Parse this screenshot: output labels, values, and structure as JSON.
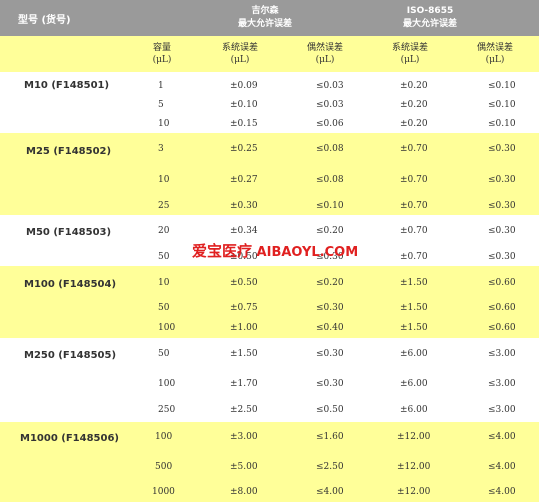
{
  "header": {
    "model_label": "型号 (货号)",
    "gilson": {
      "line1": "吉尔森",
      "line2": "最大允许误差"
    },
    "iso": {
      "line1": "ISO-8655",
      "line2": "最大允许误差"
    }
  },
  "subheader": {
    "volume": {
      "line1": "容量",
      "line2": "(μL)"
    },
    "systematic_gilson": {
      "line1": "系统误差",
      "line2": "(μL)"
    },
    "random_gilson": {
      "line1": "偶然误差",
      "line2": "(μL)"
    },
    "systematic_iso": {
      "line1": "系统误差",
      "line2": "(μL)"
    },
    "random_iso": {
      "line1": "偶然误差",
      "line2": "(μL)"
    }
  },
  "groups": [
    {
      "model": "M10 (F148501)",
      "rows": [
        {
          "volume": "1",
          "sys1": "±0.09",
          "ran1": "≤0.03",
          "sys2": "±0.20",
          "ran2": "≤0.10"
        },
        {
          "volume": "5",
          "sys1": "±0.10",
          "ran1": "≤0.03",
          "sys2": "±0.20",
          "ran2": "≤0.10"
        },
        {
          "volume": "10",
          "sys1": "±0.15",
          "ran1": "≤0.06",
          "sys2": "±0.20",
          "ran2": "≤0.10"
        }
      ]
    },
    {
      "model": "M25 (F148502)",
      "rows": [
        {
          "volume": "3",
          "sys1": "±0.25",
          "ran1": "≤0.08",
          "sys2": "±0.70",
          "ran2": "≤0.30"
        },
        {
          "volume": "10",
          "sys1": "±0.27",
          "ran1": "≤0.08",
          "sys2": "±0.70",
          "ran2": "≤0.30"
        },
        {
          "volume": "25",
          "sys1": "±0.30",
          "ran1": "≤0.10",
          "sys2": "±0.70",
          "ran2": "≤0.30"
        }
      ]
    },
    {
      "model": "M50 (F148503)",
      "rows": [
        {
          "volume": "20",
          "sys1": "±0.34",
          "ran1": "≤0.20",
          "sys2": "±0.70",
          "ran2": "≤0.30"
        },
        {
          "volume": "50",
          "sys1": "±0.50",
          "ran1": "≤0.30",
          "sys2": "±0.70",
          "ran2": "≤0.30"
        }
      ]
    },
    {
      "model": "M100 (F148504)",
      "rows": [
        {
          "volume": "10",
          "sys1": "±0.50",
          "ran1": "≤0.20",
          "sys2": "±1.50",
          "ran2": "≤0.60"
        },
        {
          "volume": "50",
          "sys1": "±0.75",
          "ran1": "≤0.30",
          "sys2": "±1.50",
          "ran2": "≤0.60"
        },
        {
          "volume": "100",
          "sys1": "±1.00",
          "ran1": "≤0.40",
          "sys2": "±1.50",
          "ran2": "≤0.60"
        }
      ]
    },
    {
      "model": "M250 (F148505)",
      "rows": [
        {
          "volume": "50",
          "sys1": "±1.50",
          "ran1": "≤0.30",
          "sys2": "±6.00",
          "ran2": "≤3.00"
        },
        {
          "volume": "100",
          "sys1": "±1.70",
          "ran1": "≤0.30",
          "sys2": "±6.00",
          "ran2": "≤3.00"
        },
        {
          "volume": "250",
          "sys1": "±2.50",
          "ran1": "≤0.50",
          "sys2": "±6.00",
          "ran2": "≤3.00"
        }
      ]
    },
    {
      "model": "M1000 (F148506)",
      "rows": [
        {
          "volume": "100",
          "sys1": "±3.00",
          "ran1": "≤1.60",
          "sys2": "±12.00",
          "ran2": "≤4.00"
        },
        {
          "volume": "500",
          "sys1": "±5.00",
          "ran1": "≤2.50",
          "sys2": "±12.00",
          "ran2": "≤4.00"
        },
        {
          "volume": "1000",
          "sys1": "±8.00",
          "ran1": "≤4.00",
          "sys2": "±12.00",
          "ran2": "≤4.00"
        }
      ]
    }
  ],
  "watermark": {
    "cn": "爱宝医疗",
    "en": " AIBAOYL.COM"
  },
  "colors": {
    "header_bg": "#9a9a9a",
    "band_yellow": "#ffff99",
    "watermark": "#e02020"
  }
}
